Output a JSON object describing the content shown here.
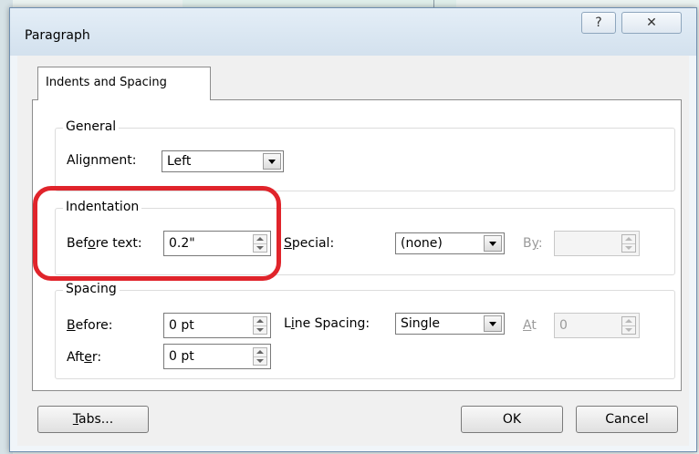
{
  "dialog": {
    "title": "Paragraph",
    "help_glyph": "?",
    "close_glyph": "✕"
  },
  "tabs": [
    {
      "label": "Indents and Spacing",
      "selected": true
    }
  ],
  "general": {
    "legend": "General",
    "alignment_label_pre": "Ali",
    "alignment_label_u": "g",
    "alignment_label_post": "nment:",
    "alignment_value": "Left"
  },
  "indentation": {
    "legend": "Indentation",
    "before_text_pre": "Bef",
    "before_text_u": "o",
    "before_text_post": "re text:",
    "before_text_value": "0.2\"",
    "special_u": "S",
    "special_post": "pecial:",
    "special_value": "(none)",
    "by_pre": "B",
    "by_u": "y",
    "by_post": ":",
    "by_value": ""
  },
  "spacing": {
    "legend": "Spacing",
    "before_u": "B",
    "before_post": "efore:",
    "before_value": "0 pt",
    "after_pre": "Aft",
    "after_u": "e",
    "after_post": "r:",
    "after_value": "0 pt",
    "line_spacing_pre": "L",
    "line_spacing_u": "i",
    "line_spacing_post": "ne Spacing:",
    "line_spacing_value": "Single",
    "at_u": "A",
    "at_post": "t",
    "at_value": "0"
  },
  "buttons": {
    "tabs_u": "T",
    "tabs_post": "abs...",
    "ok": "OK",
    "cancel": "Cancel"
  },
  "colors": {
    "highlight": "#e0242b"
  }
}
